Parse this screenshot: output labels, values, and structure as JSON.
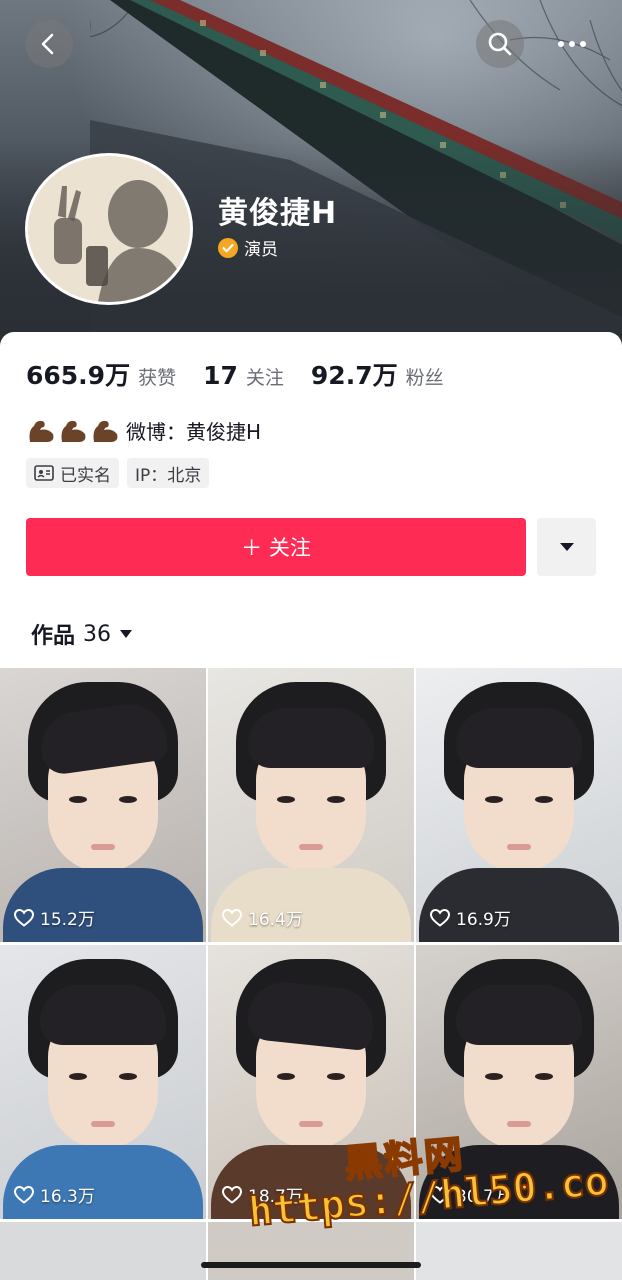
{
  "header": {
    "back_icon": "back-icon",
    "search_icon": "search-icon",
    "more_icon": "more-icon"
  },
  "profile": {
    "name": "黄俊捷H",
    "verified_label": "演员",
    "verified_color": "#f5a623"
  },
  "stats": [
    {
      "value": "665.9万",
      "label": "获赞"
    },
    {
      "value": "17",
      "label": "关注"
    },
    {
      "value": "92.7万",
      "label": "粉丝"
    }
  ],
  "bio": {
    "emoji": "💪💪💪",
    "text": "微博：黄俊捷H"
  },
  "tags": [
    {
      "icon": "id-card-icon",
      "label": "已实名"
    },
    {
      "label": "IP：北京"
    }
  ],
  "actions": {
    "follow_label": "＋ 关注",
    "follow_color": "#fe2c55",
    "dropdown_icon": "caret-down-icon"
  },
  "works": {
    "label": "作品",
    "count": "36"
  },
  "videos": [
    {
      "likes": "15.2万"
    },
    {
      "likes": "16.4万"
    },
    {
      "likes": "16.9万"
    },
    {
      "likes": "16.3万"
    },
    {
      "likes": "18.7万"
    },
    {
      "likes": "30.7万"
    }
  ],
  "watermark": {
    "line1": "黑料网",
    "line2": "https://hl50.co"
  }
}
